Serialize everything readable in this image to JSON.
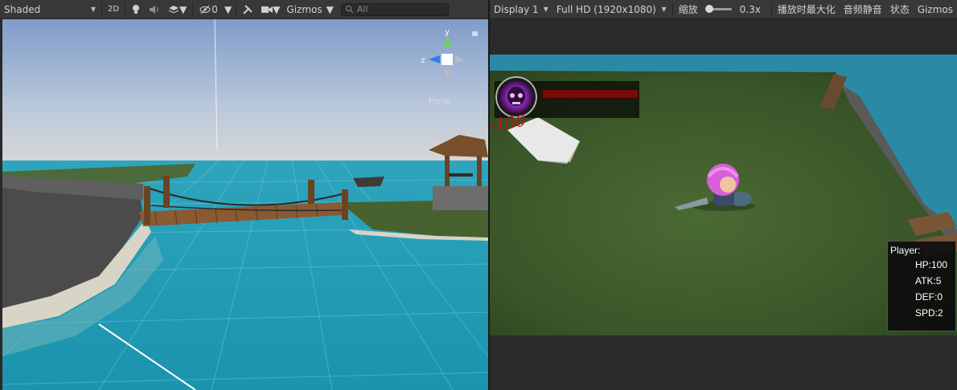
{
  "scene_toolbar": {
    "shading_mode": "Shaded",
    "mode_2d": "2D",
    "hidden_count": "0",
    "gizmos": "Gizmos",
    "search_placeholder": "All"
  },
  "game_toolbar": {
    "display": "Display 1",
    "resolution": "Full HD (1920x1080)",
    "scale_label": "缩放",
    "scale_value": "0.3x",
    "maximize_on_play": "播放时最大化",
    "mute_audio": "音频静音",
    "stats": "状态",
    "gizmos": "Gizmos"
  },
  "scene_gizmo": {
    "axis_y": "y",
    "axis_z": "z",
    "projection": "Persp"
  },
  "game_hud": {
    "damage_text": "-100",
    "player_title": "Player:",
    "hp": "HP:100",
    "atk": "ATK:5",
    "def": "DEF:0",
    "spd": "SPD:2"
  },
  "colors": {
    "toolbar_bg": "#383838",
    "sky_top": "#8eaad4",
    "water": "#22a0b6",
    "grass": "#3f5a2a",
    "hp_fill": "#a01414",
    "portrait_glow": "#b03ad8"
  }
}
